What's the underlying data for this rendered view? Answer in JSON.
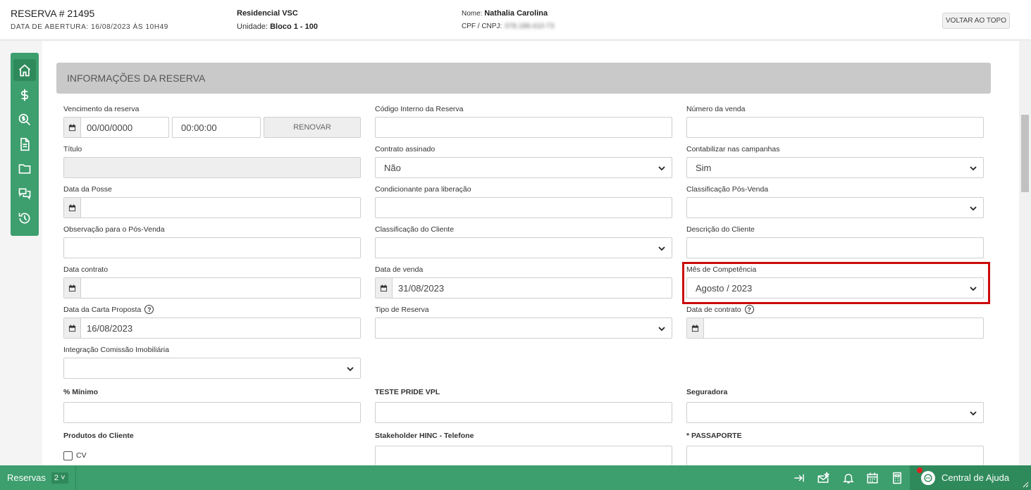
{
  "header": {
    "title": "RESERVA # 21495",
    "opened": "DATA DE ABERTURA: 16/08/2023 ÀS 10H49",
    "empreendimento": "Residencial VSC",
    "unidade_label": "Unidade:",
    "unidade_value": "Bloco 1 - 100",
    "nome_label": "Nome:",
    "nome_value": "Nathalia Carolina",
    "cpf_label": "CPF / CNPJ:",
    "cpf_value": "078.188.410-73",
    "back_to_top": "VOLTAR AO TOPO"
  },
  "sidebar": {
    "items": [
      {
        "icon": "home-icon"
      },
      {
        "icon": "dollar-icon"
      },
      {
        "icon": "search-dollar-icon"
      },
      {
        "icon": "document-icon"
      },
      {
        "icon": "folder-icon"
      },
      {
        "icon": "chat-icon"
      },
      {
        "icon": "history-icon"
      }
    ]
  },
  "section": {
    "title": "INFORMAÇÕES DA RESERVA"
  },
  "fields": {
    "vencimento": {
      "label": "Vencimento da reserva",
      "date": "00/00/0000",
      "time": "00:00:00",
      "renew": "RENOVAR"
    },
    "codigo_interno": {
      "label": "Código Interno da Reserva",
      "value": ""
    },
    "numero_venda": {
      "label": "Número da venda",
      "value": ""
    },
    "titulo": {
      "label": "Título",
      "value": ""
    },
    "contrato_assinado": {
      "label": "Contrato assinado",
      "value": "Não"
    },
    "contabilizar": {
      "label": "Contabilizar nas campanhas",
      "value": "Sim"
    },
    "data_posse": {
      "label": "Data da Posse",
      "value": ""
    },
    "condicionante": {
      "label": "Condicionante para liberação",
      "value": ""
    },
    "classificacao_pos": {
      "label": "Classificação Pós-Venda",
      "value": ""
    },
    "observacao_pos": {
      "label": "Observação para o Pós-Venda",
      "value": ""
    },
    "classificacao_cliente": {
      "label": "Classificação do Cliente",
      "value": ""
    },
    "descricao_cliente": {
      "label": "Descrição do Cliente",
      "value": ""
    },
    "data_contrato": {
      "label": "Data contrato",
      "value": ""
    },
    "data_venda": {
      "label": "Data de venda",
      "value": "31/08/2023"
    },
    "mes_competencia": {
      "label": "Mês de Competência",
      "value": "Agosto / 2023"
    },
    "data_carta": {
      "label": "Data da Carta Proposta",
      "value": "16/08/2023"
    },
    "tipo_reserva": {
      "label": "Tipo de Reserva",
      "value": ""
    },
    "data_de_contrato": {
      "label": "Data de contrato",
      "value": ""
    },
    "integracao": {
      "label": "Integração Comissão Imobiliária",
      "value": ""
    },
    "minimo": {
      "label": "% Mínimo",
      "value": ""
    },
    "teste_pride": {
      "label": "TESTE PRIDE VPL",
      "value": ""
    },
    "seguradora": {
      "label": "Seguradora",
      "value": ""
    },
    "produtos": {
      "label": "Produtos do Cliente",
      "option": "CV"
    },
    "stakeholder": {
      "label": "Stakeholder HINC - Telefone",
      "value": ""
    },
    "passaporte": {
      "label": "* PASSAPORTE",
      "value": ""
    }
  },
  "help_glyph": "?",
  "bottombar": {
    "tab_label": "Reservas",
    "tab_count": "2",
    "tab_chevron": "˅",
    "help_label": "Central de Ajuda"
  }
}
